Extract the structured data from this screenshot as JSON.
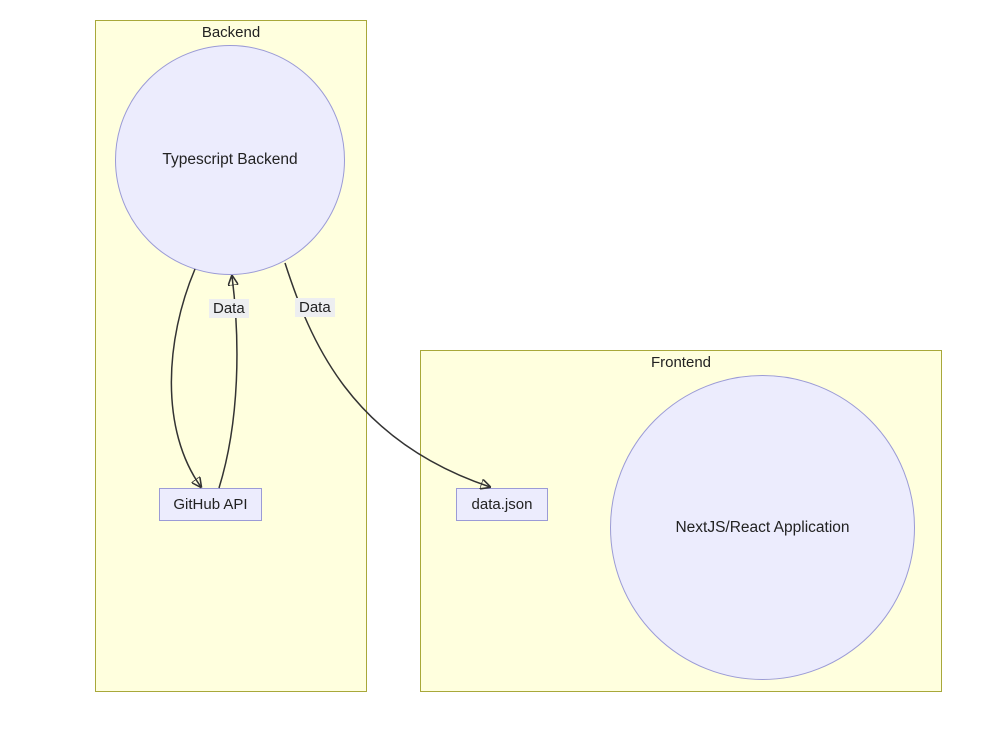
{
  "groups": {
    "backend": {
      "title": "Backend"
    },
    "frontend": {
      "title": "Frontend"
    }
  },
  "nodes": {
    "ts_backend": {
      "label": "Typescript Backend"
    },
    "github_api": {
      "label": "GitHub API"
    },
    "data_json": {
      "label": "data.json"
    },
    "react_app": {
      "label": "NextJS/React Application"
    }
  },
  "edges": {
    "backend_to_github": {
      "label": "Data"
    },
    "github_to_backend": {
      "label": ""
    },
    "backend_to_datajson": {
      "label": "Data"
    }
  }
}
